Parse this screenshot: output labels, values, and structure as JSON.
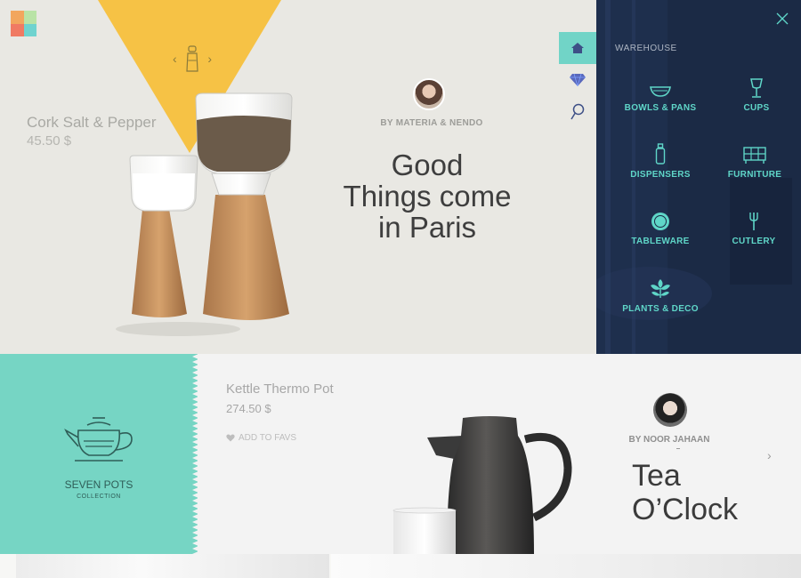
{
  "hero": {
    "product_name": "Cork Salt & Pepper",
    "product_price": "45.50  $",
    "author": "BY MATERIA & NENDO",
    "headline_lines": [
      "Good",
      "Things come",
      "in Paris"
    ],
    "accent_color": "#f6c245",
    "carousel": {
      "prev": "‹",
      "next": "›"
    }
  },
  "rail": {
    "items": [
      {
        "icon": "home-icon",
        "active": true
      },
      {
        "icon": "diamond-icon",
        "active": false
      },
      {
        "icon": "search-icon",
        "active": false
      }
    ]
  },
  "menu": {
    "title": "WAREHOUSE",
    "close_icon": "close-icon",
    "items": [
      {
        "label": "BOWLS  &  PANS",
        "icon": "bowl-icon"
      },
      {
        "label": "CUPS",
        "icon": "cup-icon"
      },
      {
        "label": "DISPENSERS",
        "icon": "dispenser-icon"
      },
      {
        "label": "FURNITURE",
        "icon": "furniture-icon"
      },
      {
        "label": "TABLEWARE",
        "icon": "plate-icon"
      },
      {
        "label": "CUTLERY",
        "icon": "fork-icon"
      },
      {
        "label": "PLANTS & DECO",
        "icon": "plant-icon"
      }
    ],
    "accent_color": "#5fd6c8"
  },
  "collection": {
    "title": "SEVEN POTS",
    "subtitle": "COLLECTION",
    "icon": "teapot-icon",
    "color": "#76d5c4"
  },
  "feature": {
    "product_name": "Kettle Thermo Pot",
    "product_price": "274.50  $",
    "fav_label": "ADD TO FAVS",
    "author": "BY NOOR JAHAAN",
    "headline_lines": [
      "Tea",
      "O’Clock"
    ],
    "next": "›"
  }
}
